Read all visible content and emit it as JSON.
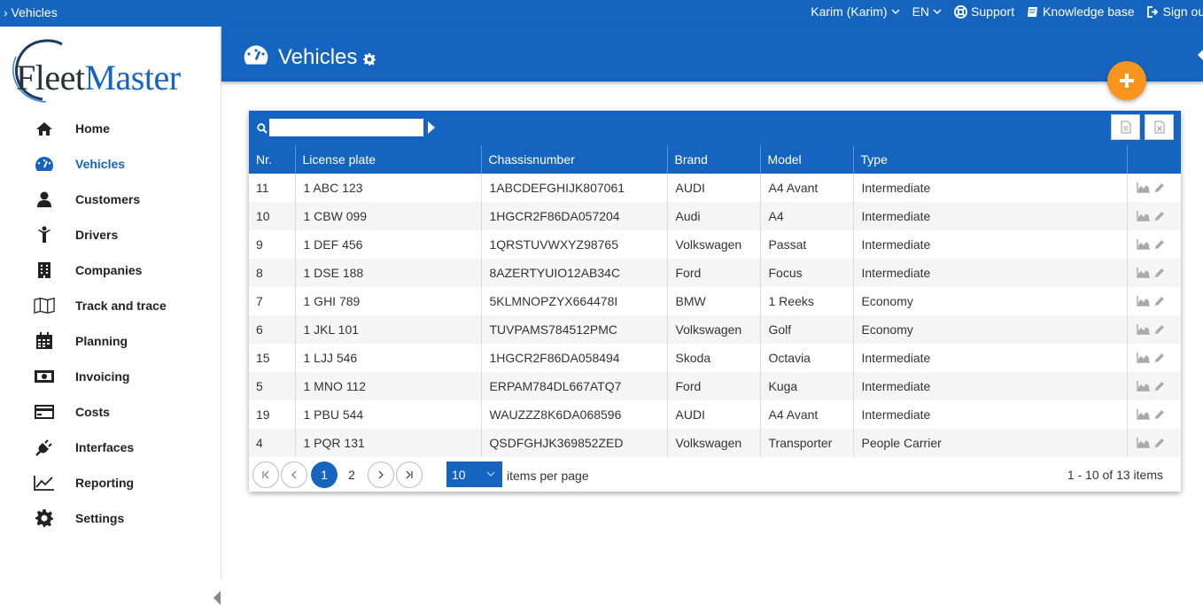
{
  "topbar": {
    "breadcrumb": "› Vehicles",
    "user": "Karim (Karim)",
    "language": "EN",
    "support": "Support",
    "knowledge_base": "Knowledge base",
    "sign_out": "Sign out"
  },
  "logo": {
    "part1": "Fleet",
    "part2": "Master"
  },
  "sidebar": {
    "items": [
      {
        "label": "Home",
        "icon": "home-icon"
      },
      {
        "label": "Vehicles",
        "icon": "gauge-icon",
        "active": true
      },
      {
        "label": "Customers",
        "icon": "user-icon"
      },
      {
        "label": "Drivers",
        "icon": "driver-icon"
      },
      {
        "label": "Companies",
        "icon": "building-icon"
      },
      {
        "label": "Track and trace",
        "icon": "map-icon"
      },
      {
        "label": "Planning",
        "icon": "calendar-icon"
      },
      {
        "label": "Invoicing",
        "icon": "money-icon"
      },
      {
        "label": "Costs",
        "icon": "credit-card-icon"
      },
      {
        "label": "Interfaces",
        "icon": "plug-icon"
      },
      {
        "label": "Reporting",
        "icon": "line-chart-icon"
      },
      {
        "label": "Settings",
        "icon": "gear-icon"
      }
    ]
  },
  "header": {
    "title": "Vehicles"
  },
  "colors": {
    "primary": "#1565c0",
    "accent": "#f7941d"
  },
  "grid": {
    "search": {
      "value": "",
      "placeholder": ""
    },
    "columns": [
      "Nr.",
      "License plate",
      "Chassisnumber",
      "Brand",
      "Model",
      "Type"
    ],
    "rows": [
      [
        "11",
        "1 ABC 123",
        "1ABCDEFGHIJK807061",
        "AUDI",
        "A4 Avant",
        "Intermediate"
      ],
      [
        "10",
        "1 CBW 099",
        "1HGCR2F86DA057204",
        "Audi",
        "A4",
        "Intermediate"
      ],
      [
        "9",
        "1 DEF 456",
        "1QRSTUVWXYZ98765",
        "Volkswagen",
        "Passat",
        "Intermediate"
      ],
      [
        "8",
        "1 DSE 188",
        "8AZERTYUIO12AB34C",
        "Ford",
        "Focus",
        "Intermediate"
      ],
      [
        "7",
        "1 GHI 789",
        "5KLMNOPZYX664478I",
        "BMW",
        "1 Reeks",
        "Economy"
      ],
      [
        "6",
        "1 JKL 101",
        "TUVPAMS784512PMC",
        "Volkswagen",
        "Golf",
        "Economy"
      ],
      [
        "15",
        "1 LJJ 546",
        "1HGCR2F86DA058494",
        "Skoda",
        "Octavia",
        "Intermediate"
      ],
      [
        "5",
        "1 MNO 112",
        "ERPAM784DL667ATQ7",
        "Ford",
        "Kuga",
        "Intermediate"
      ],
      [
        "19",
        "1 PBU 544",
        "WAUZZZ8K6DA068596",
        "AUDI",
        "A4 Avant",
        "Intermediate"
      ],
      [
        "4",
        "1 PQR 131",
        "QSDFGHJK369852ZED",
        "Volkswagen",
        "Transporter",
        "People Carrier"
      ]
    ],
    "pager": {
      "pages": [
        "1",
        "2"
      ],
      "current_page": "1",
      "page_size": "10",
      "items_per_page_label": "items per page",
      "info": "1 - 10 of 13 items"
    }
  }
}
